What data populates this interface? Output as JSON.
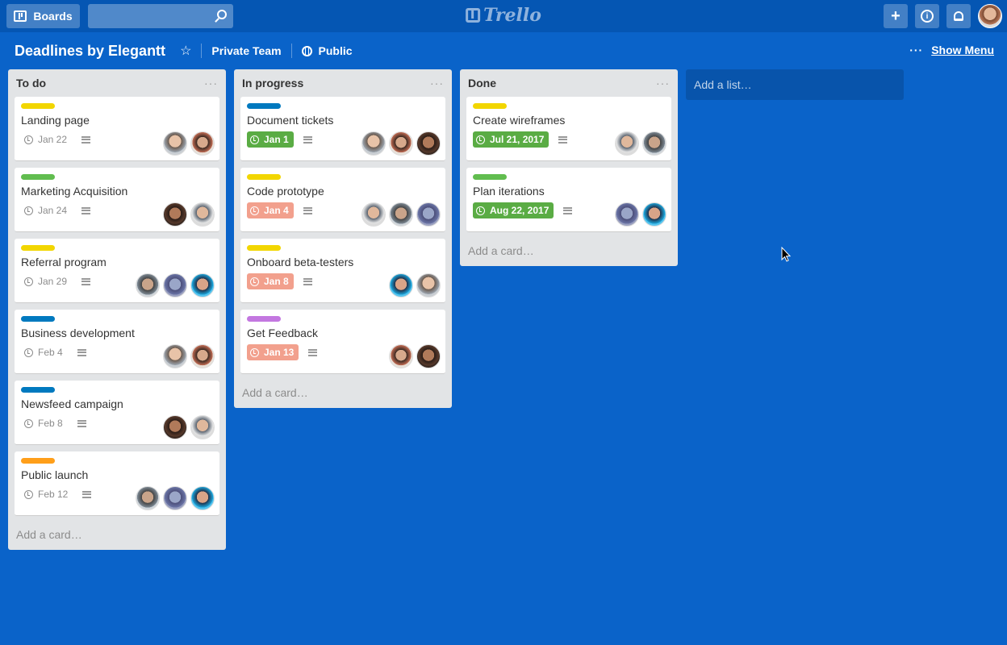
{
  "topbar": {
    "boards_label": "Boards",
    "search_placeholder": "",
    "logo_text": "Trello"
  },
  "board": {
    "title": "Deadlines by Elegantt",
    "team": "Private Team",
    "visibility": "Public",
    "show_menu": "Show Menu"
  },
  "colors": {
    "background": "#0a63c9",
    "label_yellow": "#f2d600",
    "label_green": "#61bd4f",
    "label_blue": "#0079bf",
    "label_orange": "#ff9f1a",
    "label_purple": "#c377e0",
    "due_green": "#5aac44",
    "due_red": "#f2a08d"
  },
  "lists": [
    {
      "title": "To do",
      "add_card": "Add a card…",
      "cards": [
        {
          "label_color": "yellow",
          "title": "Landing page",
          "due": "Jan 22",
          "due_state": "none",
          "avatars": 2
        },
        {
          "label_color": "green",
          "title": "Marketing Acquisition",
          "due": "Jan 24",
          "due_state": "none",
          "avatars": 2
        },
        {
          "label_color": "yellow",
          "title": "Referral program",
          "due": "Jan 29",
          "due_state": "none",
          "avatars": 3
        },
        {
          "label_color": "blue",
          "title": "Business development",
          "due": "Feb 4",
          "due_state": "none",
          "avatars": 2
        },
        {
          "label_color": "blue",
          "title": "Newsfeed campaign",
          "due": "Feb 8",
          "due_state": "none",
          "avatars": 2
        },
        {
          "label_color": "orange",
          "title": "Public launch",
          "due": "Feb 12",
          "due_state": "none",
          "avatars": 3
        }
      ]
    },
    {
      "title": "In progress",
      "add_card": "Add a card…",
      "cards": [
        {
          "label_color": "blue",
          "title": "Document tickets",
          "due": "Jan 1",
          "due_state": "complete",
          "avatars": 3
        },
        {
          "label_color": "yellow",
          "title": "Code prototype",
          "due": "Jan 4",
          "due_state": "overdue",
          "avatars": 3
        },
        {
          "label_color": "yellow",
          "title": "Onboard beta-testers",
          "due": "Jan 8",
          "due_state": "overdue",
          "avatars": 2
        },
        {
          "label_color": "purple",
          "title": "Get Feedback",
          "due": "Jan 13",
          "due_state": "overdue",
          "avatars": 2
        }
      ]
    },
    {
      "title": "Done",
      "add_card": "Add a card…",
      "cards": [
        {
          "label_color": "yellow",
          "title": "Create wireframes",
          "due": "Jul 21, 2017",
          "due_state": "complete",
          "avatars": 2
        },
        {
          "label_color": "green",
          "title": "Plan iterations",
          "due": "Aug 22, 2017",
          "due_state": "complete",
          "avatars": 2
        }
      ]
    }
  ],
  "add_list": "Add a list…"
}
